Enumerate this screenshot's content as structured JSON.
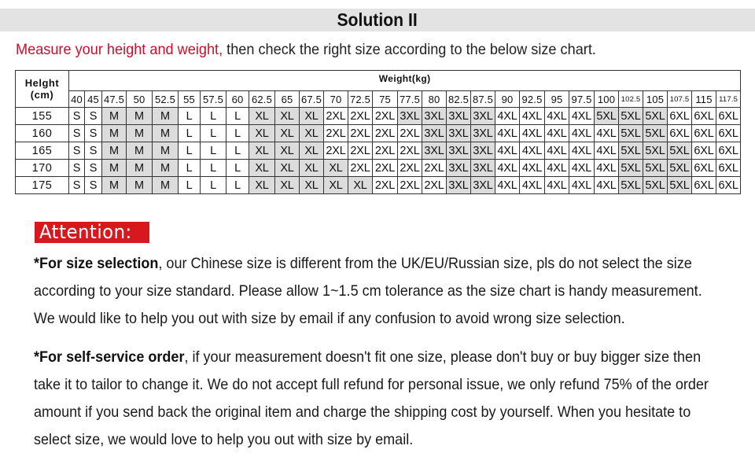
{
  "title": "Solution II",
  "instruction": {
    "highlight": "Measure your height and weight,",
    "rest": " then check the right size according to the below size chart."
  },
  "colors": {
    "title_bar_bg": "#e3e3e3",
    "accent_red": "#c8102e",
    "attention_bg": "#d6181f",
    "shaded_cell": "#dcdcdc"
  },
  "size_chart": {
    "height_header_line1": "Helght",
    "height_header_line2": "(cm)",
    "weight_header": "Weight(kg)",
    "weights": [
      "40",
      "45",
      "47.5",
      "50",
      "52.5",
      "55",
      "57.5",
      "60",
      "62.5",
      "65",
      "67.5",
      "70",
      "72.5",
      "75",
      "77.5",
      "80",
      "82.5",
      "87.5",
      "90",
      "92.5",
      "95",
      "97.5",
      "100",
      "102.5",
      "105",
      "107.5",
      "115",
      "117.5"
    ],
    "rows": [
      {
        "height": "155",
        "sizes": [
          "S",
          "S",
          "M",
          "M",
          "M",
          "L",
          "L",
          "L",
          "XL",
          "XL",
          "XL",
          "2XL",
          "2XL",
          "2XL",
          "3XL",
          "3XL",
          "3XL",
          "3XL",
          "4XL",
          "4XL",
          "4XL",
          "4XL",
          "5XL",
          "5XL",
          "5XL",
          "6XL",
          "6XL",
          "6XL"
        ]
      },
      {
        "height": "160",
        "sizes": [
          "S",
          "S",
          "M",
          "M",
          "M",
          "L",
          "L",
          "L",
          "XL",
          "XL",
          "XL",
          "2XL",
          "2XL",
          "2XL",
          "2XL",
          "3XL",
          "3XL",
          "3XL",
          "4XL",
          "4XL",
          "4XL",
          "4XL",
          "4XL",
          "5XL",
          "5XL",
          "6XL",
          "6XL",
          "6XL"
        ]
      },
      {
        "height": "165",
        "sizes": [
          "S",
          "S",
          "M",
          "M",
          "M",
          "L",
          "L",
          "L",
          "XL",
          "XL",
          "XL",
          "2XL",
          "2XL",
          "2XL",
          "2XL",
          "3XL",
          "3XL",
          "3XL",
          "4XL",
          "4XL",
          "4XL",
          "4XL",
          "4XL",
          "5XL",
          "5XL",
          "5XL",
          "6XL",
          "6XL"
        ]
      },
      {
        "height": "170",
        "sizes": [
          "S",
          "S",
          "M",
          "M",
          "M",
          "L",
          "L",
          "L",
          "XL",
          "XL",
          "XL",
          "XL",
          "2XL",
          "2XL",
          "2XL",
          "2XL",
          "3XL",
          "3XL",
          "4XL",
          "4XL",
          "4XL",
          "4XL",
          "4XL",
          "5XL",
          "5XL",
          "5XL",
          "6XL",
          "6XL"
        ]
      },
      {
        "height": "175",
        "sizes": [
          "S",
          "S",
          "M",
          "M",
          "M",
          "L",
          "L",
          "L",
          "XL",
          "XL",
          "XL",
          "XL",
          "XL",
          "2XL",
          "2XL",
          "2XL",
          "3XL",
          "3XL",
          "4XL",
          "4XL",
          "4XL",
          "4XL",
          "4XL",
          "5XL",
          "5XL",
          "5XL",
          "6XL",
          "6XL"
        ]
      }
    ],
    "shaded_sizes": [
      "M",
      "XL",
      "3XL",
      "5XL"
    ]
  },
  "attention": {
    "label": "Attention:",
    "para1": {
      "bold": "*For size selection",
      "lines": [
        ", our Chinese size is different from the UK/EU/Russian size, pls do not select the size",
        "according to your size standard. Please allow 1~1.5 cm tolerance as the size chart is handy measurement.",
        "We would like to help you out with size by email if any confusion to avoid wrong size selection."
      ]
    },
    "para2": {
      "bold": "*For self-service order",
      "lines": [
        ", if your measurement doesn't fit one size, please don't buy or buy bigger size then",
        "take it to tailor to change it. We do not accept full refund for personal issue, we only refund 75% of the order",
        "amount if you send back the original item and charge the shipping cost by yourself.  When you hesitate to",
        "select size, we would love to help you out with size by email."
      ]
    }
  }
}
